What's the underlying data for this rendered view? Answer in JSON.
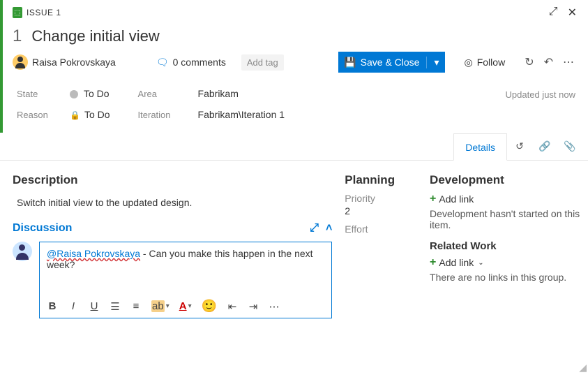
{
  "crumb": "ISSUE 1",
  "issue": {
    "number": "1",
    "title": "Change initial view"
  },
  "assignee": "Raisa Pokrovskaya",
  "comments": {
    "count": "0 comments"
  },
  "addTag": "Add tag",
  "buttons": {
    "save": "Save & Close",
    "follow": "Follow"
  },
  "updated": "Updated just now",
  "fields": {
    "stateLabel": "State",
    "stateValue": "To Do",
    "reasonLabel": "Reason",
    "reasonValue": "To Do",
    "areaLabel": "Area",
    "areaValue": "Fabrikam",
    "iterationLabel": "Iteration",
    "iterationValue": "Fabrikam\\Iteration 1"
  },
  "tabs": {
    "details": "Details"
  },
  "description": {
    "heading": "Description",
    "body": "Switch initial view to the updated design."
  },
  "discussion": {
    "heading": "Discussion",
    "mention": "@Raisa Pokrovskaya",
    "rest": " - Can you make this happen in the next week?"
  },
  "planning": {
    "heading": "Planning",
    "priorityLabel": "Priority",
    "priorityValue": "2",
    "effortLabel": "Effort"
  },
  "development": {
    "heading": "Development",
    "addLink": "Add link",
    "helper": "Development hasn't started on this item."
  },
  "related": {
    "heading": "Related Work",
    "addLink": "Add link",
    "helper": "There are no links in this group."
  },
  "toolbar": {
    "bold": "B",
    "italic": "I",
    "underline": "U",
    "clear": "ab",
    "fontA": "A",
    "more": "⋯"
  }
}
